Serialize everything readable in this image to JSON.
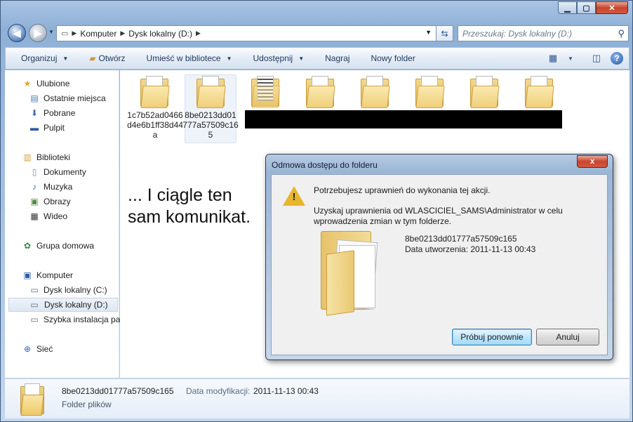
{
  "address": {
    "crumbs": [
      "Komputer",
      "Dysk lokalny (D:)"
    ]
  },
  "search": {
    "placeholder": "Przeszukaj: Dysk lokalny (D:)"
  },
  "toolbar": {
    "organize": "Organizuj",
    "open": "Otwórz",
    "library": "Umieść w bibliotece",
    "share": "Udostępnij",
    "burn": "Nagraj",
    "new_folder": "Nowy folder"
  },
  "nav": {
    "favorites": "Ulubione",
    "recent": "Ostatnie miejsca",
    "downloads": "Pobrane",
    "desktop": "Pulpit",
    "libraries": "Biblioteki",
    "documents": "Dokumenty",
    "music": "Muzyka",
    "pictures": "Obrazy",
    "video": "Wideo",
    "homegroup": "Grupa domowa",
    "computer": "Komputer",
    "drive_c": "Dysk lokalny (C:)",
    "drive_d": "Dysk lokalny (D:)",
    "quick_install": "Szybka instalacja pal",
    "network": "Sieć"
  },
  "folders": [
    {
      "label": "1c7b52ad0466d4e6b1ff38d44a"
    },
    {
      "label": "8be0213dd01777a57509c165"
    }
  ],
  "overlay_text": "... I ciągle ten\nsam komunikat.",
  "dialog": {
    "title": "Odmowa dostępu do folderu",
    "close": "x",
    "line1": "Potrzebujesz uprawnień do wykonania tej akcji.",
    "line2": "Uzyskaj uprawnienia od WLASCICIEL_SAMS\\Administrator w celu",
    "line3": "wprowadzenia zmian w tym folderze.",
    "folder_name": "8be0213dd01777a57509c165",
    "created": "Data utworzenia: 2011-11-13 00:43",
    "retry": "Próbuj ponownie",
    "cancel": "Anuluj"
  },
  "details": {
    "name": "8be0213dd01777a57509c165",
    "modified_label": "Data modyfikacji:",
    "modified_value": "2011-11-13 00:43",
    "type": "Folder plików"
  }
}
